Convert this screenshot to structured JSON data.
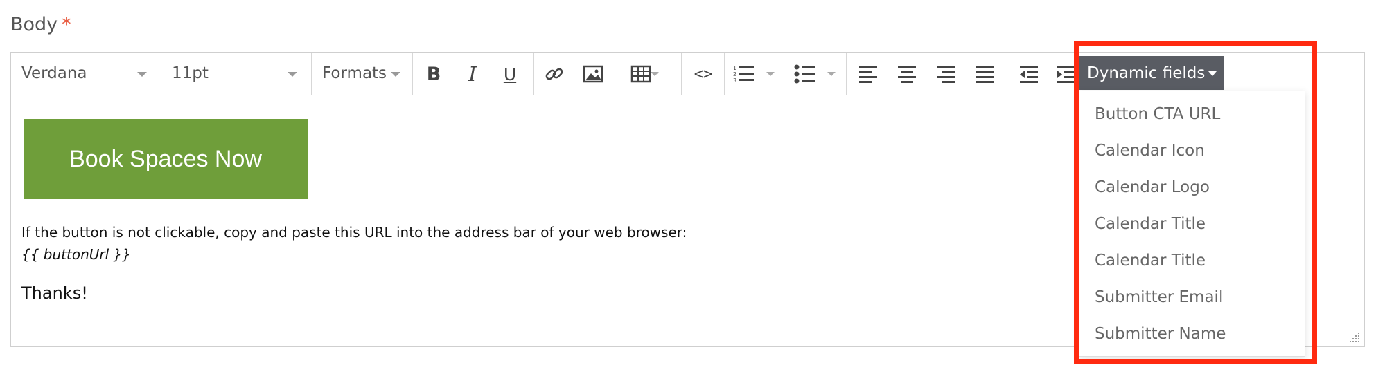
{
  "field": {
    "label": "Body",
    "required_marker": "*"
  },
  "toolbar": {
    "font_family": "Verdana",
    "font_size": "11pt",
    "formats": "Formats",
    "dynamic_fields_label": "Dynamic fields"
  },
  "dropdown": {
    "items": [
      "Button CTA URL",
      "Calendar Icon",
      "Calendar Logo",
      "Calendar Title",
      "Calendar Title",
      "Submitter Email",
      "Submitter Name"
    ]
  },
  "content": {
    "button_label": "Book Spaces Now",
    "instructions": "If the button is not clickable, copy and paste this URL into the address bar of your web browser:",
    "url_placeholder": "{{ buttonUrl }}",
    "closing": "Thanks!"
  },
  "colors": {
    "cta": "#6f9e3a",
    "dynamic_button": "#595c63",
    "highlight": "#ff2a10",
    "required": "#e8573c"
  }
}
